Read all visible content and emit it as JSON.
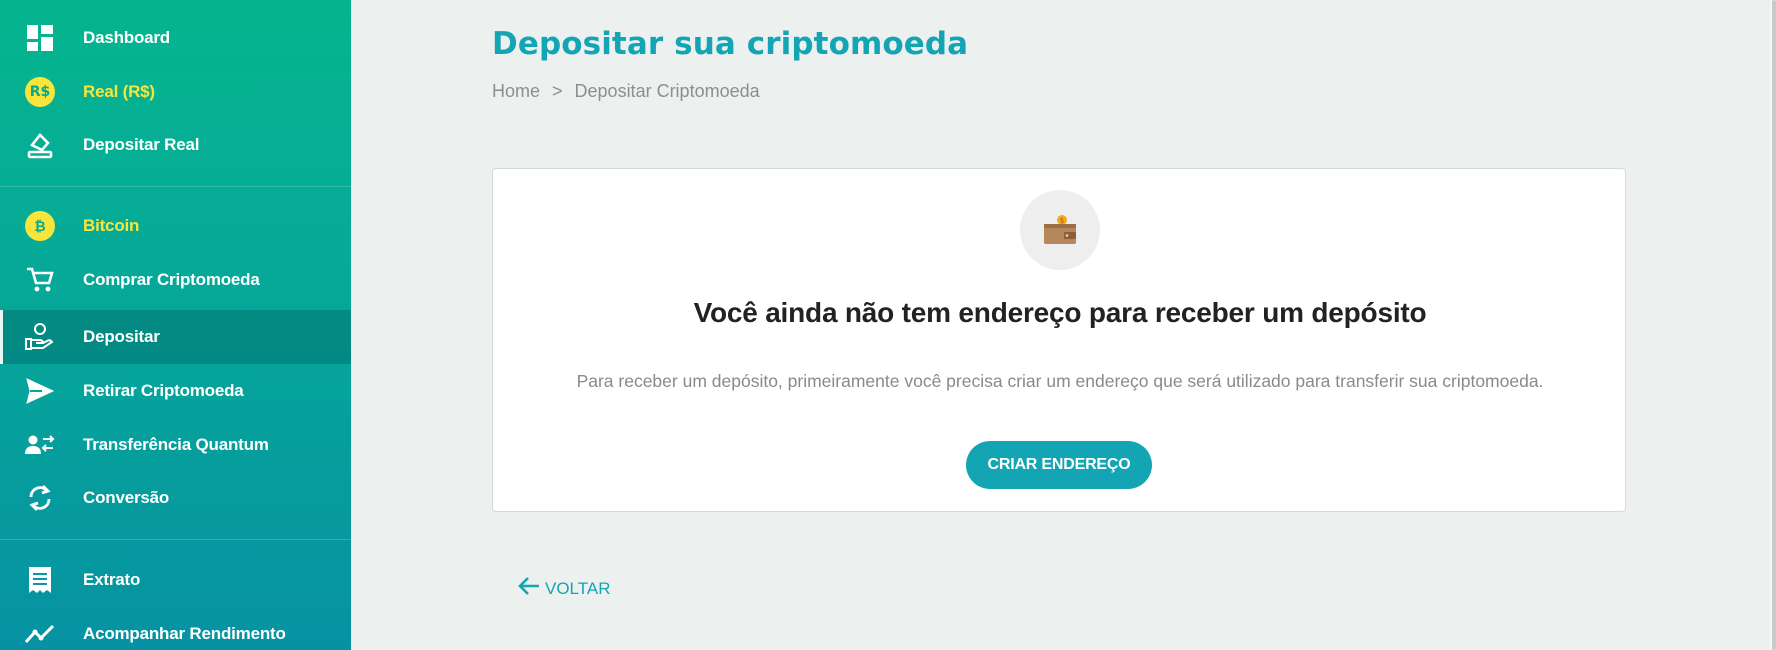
{
  "sidebar": {
    "items": [
      {
        "label": "Dashboard",
        "icon": "dashboard-icon"
      },
      {
        "label": "Real (R$)",
        "icon": "real-coin-icon",
        "badge": "R$"
      },
      {
        "label": "Depositar Real",
        "icon": "deposit-real-icon"
      },
      {
        "label": "Bitcoin",
        "icon": "bitcoin-icon",
        "badge": "₿"
      },
      {
        "label": "Comprar Criptomoeda",
        "icon": "cart-icon"
      },
      {
        "label": "Depositar",
        "icon": "hand-coin-icon"
      },
      {
        "label": "Retirar Criptomoeda",
        "icon": "send-icon"
      },
      {
        "label": "Transferência Quantum",
        "icon": "user-transfer-icon"
      },
      {
        "label": "Conversão",
        "icon": "convert-icon"
      },
      {
        "label": "Extrato",
        "icon": "receipt-icon"
      },
      {
        "label": "Acompanhar Rendimento",
        "icon": "trend-icon"
      }
    ],
    "active": "Depositar"
  },
  "header": {
    "title": "Depositar sua criptomoeda",
    "breadcrumb": [
      "Home",
      ">",
      "Depositar Criptomoeda"
    ]
  },
  "card": {
    "icon": "wallet-icon",
    "heading": "Você ainda não tem endereço para receber um depósito",
    "text": "Para receber um depósito, primeiramente você precisa criar um endereço que será utilizado para transferir sua criptomoeda.",
    "button_label": "CRIAR ENDEREÇO"
  },
  "back": {
    "label": "VOLTAR",
    "icon": "arrow-left-icon"
  },
  "colors": {
    "accent": "#13a5b3",
    "sidebar_top": "#05b58e",
    "sidebar_bottom": "#0692a2",
    "highlight_yellow": "#f8e53c"
  }
}
